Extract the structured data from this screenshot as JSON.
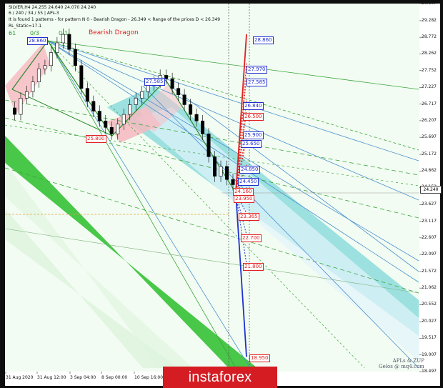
{
  "header": {
    "symbol_line": "SILVER,H4  24.255 24.640 24.070 24.240",
    "settings_line": "6 / 240 / 34 / 55 | APs-3",
    "pattern_line": "It is found 1 patterns  -  for pattern N 0 - Bearish Dragon - 26.349 < Range of the prices D < 26.349",
    "static_line": "RL_Static=17.1"
  },
  "fan_labels": {
    "left": "61",
    "mid": "0/3",
    "right": "0-1-"
  },
  "pattern_title": "Bearish Dragon",
  "current_price": "24.240",
  "brand": "instaforex",
  "watermark": {
    "line1": "APLs & ZUP",
    "line2": "Gelos @ mq4.com"
  },
  "colors": {
    "bull": "#e02020",
    "bear": "#2030d0",
    "green_zone": "#3ec43e",
    "cyan_zone": "#7fd8d8",
    "red_zone": "#f6b8c0",
    "background": "#f2fcf2"
  },
  "chart_data": {
    "type": "candlestick",
    "symbol": "SILVER",
    "timeframe": "H4",
    "ylim": [
      18.495,
      29.807
    ],
    "y_ticks": [
      "29.807",
      "29.282",
      "28.772",
      "28.262",
      "27.752",
      "27.227",
      "26.717",
      "26.207",
      "25.697",
      "25.172",
      "24.662",
      "24.152",
      "23.627",
      "23.117",
      "22.607",
      "22.097",
      "21.572",
      "21.062",
      "20.552",
      "20.027",
      "19.517",
      "19.007",
      "18.497"
    ],
    "x_ticks": [
      "31 Aug 2020",
      "31 Aug 12:00",
      "3 Sep 04:00",
      "8 Sep 00:00",
      "10 Sep 16:00"
    ],
    "price_path": [
      26.6,
      26.4,
      26.9,
      27.1,
      27.4,
      27.8,
      27.9,
      28.3,
      28.6,
      28.86,
      28.4,
      27.9,
      27.2,
      26.8,
      26.5,
      26.2,
      26.0,
      25.8,
      26.1,
      26.4,
      26.7,
      26.9,
      27.1,
      27.3,
      27.4,
      27.6,
      27.5,
      27.2,
      27.0,
      26.7,
      26.4,
      26.2,
      25.8,
      25.1,
      24.5,
      24.8,
      24.4,
      24.24
    ],
    "levels_red": [
      "28.860",
      "27.970",
      "27.585",
      "26.840",
      "26.500",
      "25.900",
      "25.650",
      "24.850",
      "24.450",
      "24.160",
      "23.950",
      "23.365",
      "22.700",
      "21.800",
      "18.950"
    ],
    "markers": [
      {
        "text": "28.860",
        "color": "blue",
        "y": 28.86
      },
      {
        "text": "27.585",
        "color": "blue",
        "y": 27.585
      },
      {
        "text": "25.800",
        "color": "red",
        "y": 25.8
      },
      {
        "text": "28.860",
        "color": "blue",
        "y": 28.86
      },
      {
        "text": "27.970",
        "color": "blue",
        "y": 27.97
      },
      {
        "text": "27.585",
        "color": "blue",
        "y": 27.585
      },
      {
        "text": "26.840",
        "color": "blue",
        "y": 26.84
      },
      {
        "text": "26.500",
        "color": "red",
        "y": 26.5
      },
      {
        "text": "25.900",
        "color": "blue",
        "y": 25.9
      },
      {
        "text": "25.650",
        "color": "blue",
        "y": 25.65
      },
      {
        "text": "24.850",
        "color": "blue",
        "y": 24.85
      },
      {
        "text": "24.450",
        "color": "blue",
        "y": 24.45
      },
      {
        "text": "24.160",
        "color": "red",
        "y": 24.16
      },
      {
        "text": "23.950",
        "color": "red",
        "y": 23.95
      },
      {
        "text": "23.365",
        "color": "red",
        "y": 23.365
      },
      {
        "text": "22.700",
        "color": "red",
        "y": 22.7
      },
      {
        "text": "21.800",
        "color": "red",
        "y": 21.8
      },
      {
        "text": "18.950",
        "color": "red",
        "y": 18.95
      }
    ]
  }
}
